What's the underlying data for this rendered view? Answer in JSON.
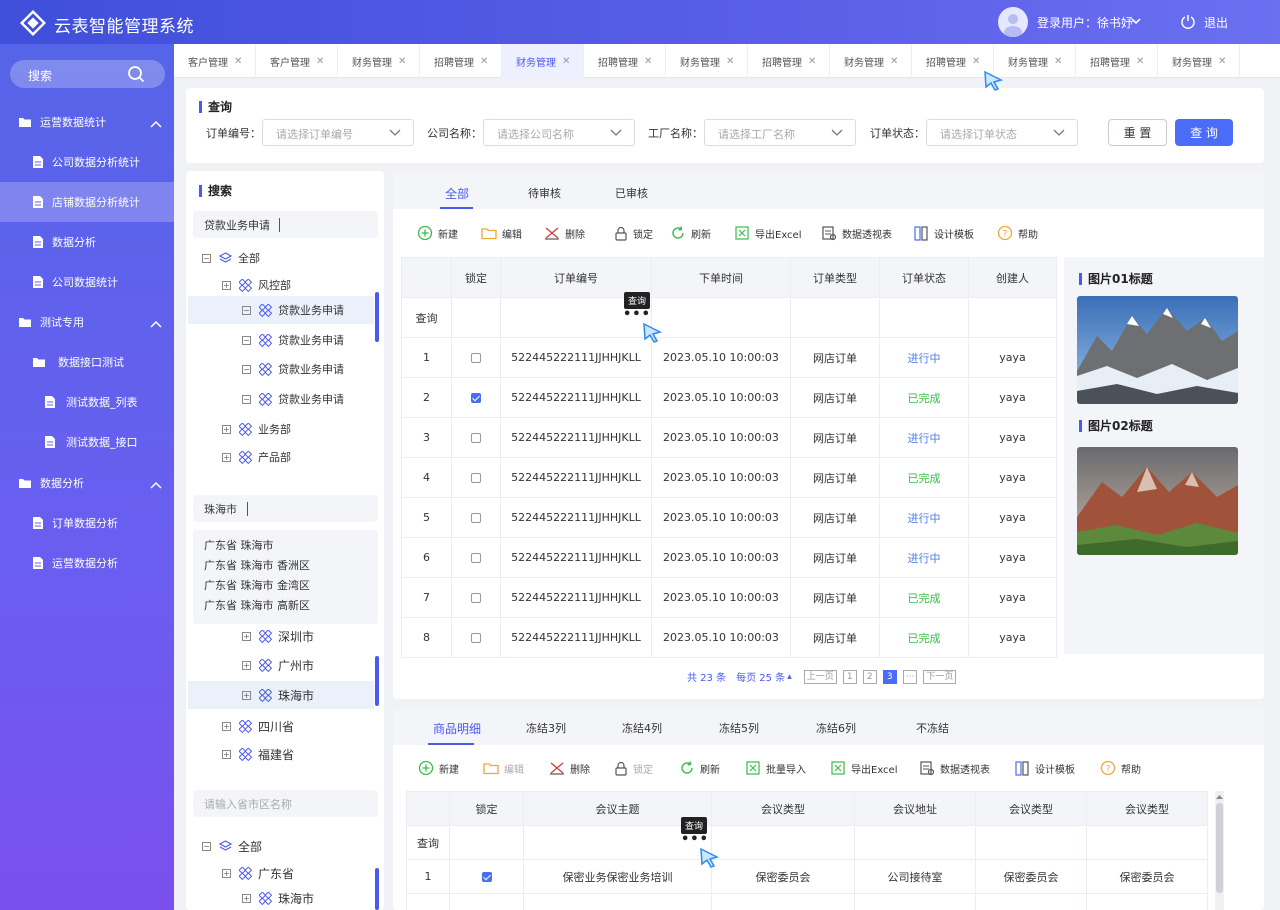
{
  "header": {
    "title": "云表智能管理系统",
    "user_label": "登录用户：徐书妤",
    "logout": "退出"
  },
  "sidebar": {
    "search": "搜索",
    "items": [
      {
        "label": "运营数据统计",
        "type": "group"
      },
      {
        "label": "公司数据分析统计",
        "type": "page"
      },
      {
        "label": "店铺数据分析统计",
        "type": "page",
        "active": true
      },
      {
        "label": "数据分析",
        "type": "page"
      },
      {
        "label": "公司数据统计",
        "type": "page"
      },
      {
        "label": "测试专用",
        "type": "group"
      },
      {
        "label": "数据接口测试",
        "type": "folder"
      },
      {
        "label": "测试数据_列表",
        "type": "page"
      },
      {
        "label": "测试数据_接口",
        "type": "page"
      },
      {
        "label": "数据分析",
        "type": "group"
      },
      {
        "label": "订单数据分析",
        "type": "page"
      },
      {
        "label": "运营数据分析",
        "type": "page"
      }
    ]
  },
  "tabs": [
    "客户管理",
    "客户管理",
    "财务管理",
    "招聘管理",
    "财务管理",
    "招聘管理",
    "财务管理",
    "招聘管理",
    "财务管理",
    "招聘管理",
    "财务管理",
    "招聘管理",
    "财务管理"
  ],
  "active_tab": 4,
  "query": {
    "title": "查询",
    "fields": [
      {
        "label": "订单编号：",
        "placeholder": "请选择订单编号"
      },
      {
        "label": "公司名称：",
        "placeholder": "请选择公司名称"
      },
      {
        "label": "工厂名称：",
        "placeholder": "请选择工厂名称"
      },
      {
        "label": "订单状态：",
        "placeholder": "请选择订单状态"
      }
    ],
    "reset": "重 置",
    "submit": "查 询"
  },
  "left": {
    "title": "搜索",
    "search1": "贷款业务申请",
    "tree1": [
      "全部",
      "风控部",
      "贷款业务申请",
      "贷款业务申请",
      "贷款业务申请",
      "贷款业务申请",
      "业务部",
      "产品部"
    ],
    "search2": "珠海市",
    "regions": [
      "广东省 珠海市",
      "广东省 珠海市 香洲区",
      "广东省 珠海市 金湾区",
      "广东省 珠海市 高新区"
    ],
    "tree2": [
      "深圳市",
      "广州市",
      "珠海市",
      "四川省",
      "福建省"
    ],
    "search3_placeholder": "请输入省市区名称",
    "tree3": [
      "全部",
      "广东省",
      "珠海市"
    ]
  },
  "main": {
    "subtabs": [
      "全部",
      "待审核",
      "已审核"
    ],
    "toolbar": [
      "新建",
      "编辑",
      "删除",
      "锁定",
      "刷新",
      "导出Excel",
      "数据透视表",
      "设计模板",
      "帮助"
    ],
    "columns": [
      "锁定",
      "订单编号",
      "下单时间",
      "订单类型",
      "订单状态",
      "创建人"
    ],
    "query_row": "查询",
    "tooltip": "查询",
    "rows": [
      {
        "n": "1",
        "checked": false,
        "id": "5224452221​11JJHHJKLL",
        "time": "2023.05.10 10:00:03",
        "type": "网店订单",
        "status": "进行中",
        "by": "yaya"
      },
      {
        "n": "2",
        "checked": true,
        "id": "5224452221​11JJHHJKLL",
        "time": "2023.05.10 10:00:03",
        "type": "网店订单",
        "status": "已完成",
        "by": "yaya"
      },
      {
        "n": "3",
        "checked": false,
        "id": "5224452221​11JJHHJKLL",
        "time": "2023.05.10 10:00:03",
        "type": "网店订单",
        "status": "进行中",
        "by": "yaya"
      },
      {
        "n": "4",
        "checked": false,
        "id": "5224452221​11JJHHJKLL",
        "time": "2023.05.10 10:00:03",
        "type": "网店订单",
        "status": "已完成",
        "by": "yaya"
      },
      {
        "n": "5",
        "checked": false,
        "id": "5224452221​11JJHHJKLL",
        "time": "2023.05.10 10:00:03",
        "type": "网店订单",
        "status": "进行中",
        "by": "yaya"
      },
      {
        "n": "6",
        "checked": false,
        "id": "5224452221​11JJHHJKLL",
        "time": "2023.05.10 10:00:03",
        "type": "网店订单",
        "status": "进行中",
        "by": "yaya"
      },
      {
        "n": "7",
        "checked": false,
        "id": "5224452221​11JJHHJKLL",
        "time": "2023.05.10 10:00:03",
        "type": "网店订单",
        "status": "已完成",
        "by": "yaya"
      },
      {
        "n": "8",
        "checked": false,
        "id": "5224452221​11JJHHJKLL",
        "time": "2023.05.10 10:00:03",
        "type": "网店订单",
        "status": "已完成",
        "by": "yaya"
      }
    ],
    "pager": {
      "total": "共 23 条",
      "per_page": "每页 25 条",
      "prev": "上一页",
      "pages": [
        "1",
        "2",
        "3",
        "···"
      ],
      "current": "3",
      "next": "下一页"
    }
  },
  "images": {
    "title1": "图片01标题",
    "title2": "图片02标题"
  },
  "bottom": {
    "subtabs": [
      "商品明细",
      "冻结3列",
      "冻结4列",
      "冻结5列",
      "冻结6列",
      "不冻结"
    ],
    "toolbar": [
      "新建",
      "编辑",
      "删除",
      "锁定",
      "刷新",
      "批量导入",
      "导出Excel",
      "数据透视表",
      "设计模板",
      "帮助"
    ],
    "columns": [
      "锁定",
      "会议主题",
      "会议类型",
      "会议地址",
      "会议类型",
      "会议类型"
    ],
    "query_row": "查询",
    "tooltip": "查询",
    "rows": [
      {
        "n": "1",
        "checked": true,
        "topic": "保密业务保密业务培训",
        "type": "保密委员会",
        "addr": "公司接待室",
        "t2": "保密委员会",
        "t3": "保密委员会"
      }
    ]
  }
}
